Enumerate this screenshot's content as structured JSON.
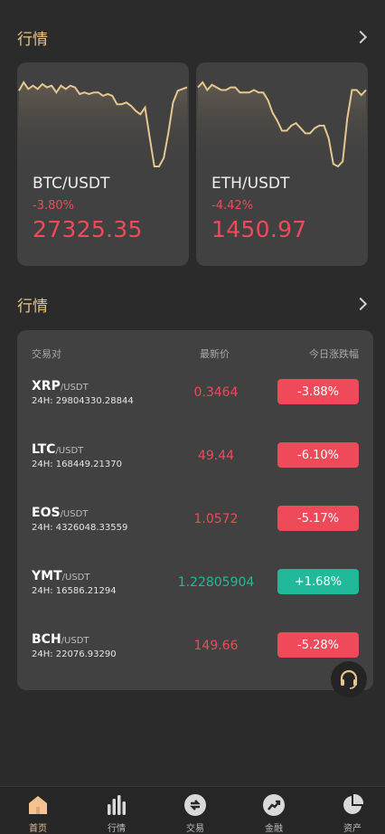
{
  "section_top": {
    "title": "行情"
  },
  "tickers": [
    {
      "pair": "BTC/USDT",
      "change": "-3.80%",
      "price": "27325.35",
      "sparkline": [
        98,
        103,
        99,
        101,
        99,
        102,
        100,
        101,
        97,
        101,
        99,
        101,
        100,
        96,
        97,
        96,
        97,
        97,
        95,
        96,
        95,
        90,
        90,
        91,
        89,
        86,
        84,
        88,
        70,
        53,
        53,
        58,
        73,
        91,
        98,
        99,
        100
      ]
    },
    {
      "pair": "ETH/USDT",
      "change": "-4.42%",
      "price": "1450.97",
      "sparkline": [
        100,
        102,
        99,
        101,
        100,
        99,
        99,
        100,
        100,
        98,
        98,
        98,
        99,
        98,
        98,
        95,
        90,
        87,
        83,
        83,
        85,
        86,
        84,
        82,
        82,
        84,
        85,
        85,
        80,
        70,
        69,
        71,
        88,
        99,
        99,
        97,
        99
      ]
    }
  ],
  "section_market": {
    "title": "行情"
  },
  "market": {
    "headers": {
      "pair": "交易对",
      "price": "最新价",
      "change": "今日涨跌幅"
    },
    "rows": [
      {
        "base": "XRP",
        "quote": "/USDT",
        "vol": "24H: 29804330.28844",
        "price": "0.3464",
        "change": "-3.88%",
        "dir": "down"
      },
      {
        "base": "LTC",
        "quote": "/USDT",
        "vol": "24H: 168449.21370",
        "price": "49.44",
        "change": "-6.10%",
        "dir": "down"
      },
      {
        "base": "EOS",
        "quote": "/USDT",
        "vol": "24H: 4326048.33559",
        "price": "1.0572",
        "change": "-5.17%",
        "dir": "down"
      },
      {
        "base": "YMT",
        "quote": "/USDT",
        "vol": "24H: 16586.21294",
        "price": "1.22805904",
        "change": "+1.68%",
        "dir": "up"
      },
      {
        "base": "BCH",
        "quote": "/USDT",
        "vol": "24H: 22076.93290",
        "price": "149.66",
        "change": "-5.28%",
        "dir": "down"
      }
    ]
  },
  "tabbar": {
    "items": [
      {
        "label": "首页",
        "icon": "home-icon",
        "active": true
      },
      {
        "label": "行情",
        "icon": "bar-chart-icon",
        "active": false
      },
      {
        "label": "交易",
        "icon": "exchange-icon",
        "active": false
      },
      {
        "label": "金融",
        "icon": "trend-up-icon",
        "active": false
      },
      {
        "label": "资产",
        "icon": "pie-chart-icon",
        "active": false
      }
    ]
  },
  "colors": {
    "accent": "#e8c38a",
    "down": "#ef4a5a",
    "up": "#22b99a",
    "card": "#414141",
    "background": "#2b2b2b"
  }
}
